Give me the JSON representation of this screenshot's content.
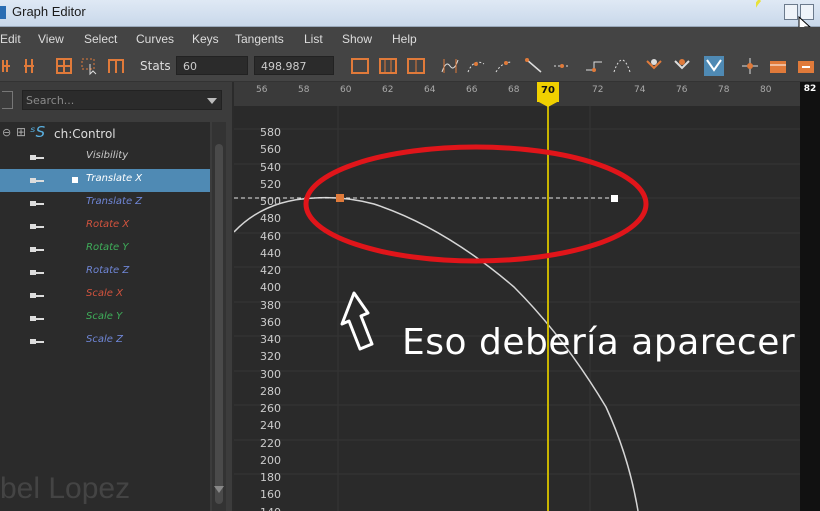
{
  "window": {
    "title": "Graph Editor"
  },
  "menu": [
    "Edit",
    "View",
    "Select",
    "Curves",
    "Keys",
    "Tangents",
    "List",
    "Show",
    "Help"
  ],
  "toolbar": {
    "stats_label": "Stats",
    "frame_value": "60",
    "value_value": "498.987"
  },
  "search": {
    "placeholder": "Search..."
  },
  "outliner": {
    "node": "ch:Control",
    "channels": [
      {
        "label": "Visibility",
        "color": "#c9c9c9",
        "selected": false
      },
      {
        "label": "Translate X",
        "color": "#ffffff",
        "selected": true
      },
      {
        "label": "Translate Z",
        "color": "#6f86d6",
        "selected": false
      },
      {
        "label": "Rotate X",
        "color": "#d2533e",
        "selected": false
      },
      {
        "label": "Rotate Y",
        "color": "#3fae5a",
        "selected": false
      },
      {
        "label": "Rotate Z",
        "color": "#6f86d6",
        "selected": false
      },
      {
        "label": "Scale X",
        "color": "#d2533e",
        "selected": false
      },
      {
        "label": "Scale Y",
        "color": "#3fae5a",
        "selected": false
      },
      {
        "label": "Scale Z",
        "color": "#6f86d6",
        "selected": false
      }
    ]
  },
  "timeline": {
    "frames": [
      "56",
      "58",
      "60",
      "62",
      "64",
      "66",
      "68",
      "72",
      "74",
      "76",
      "78",
      "80",
      "82"
    ],
    "current_frame": "70"
  },
  "value_axis": [
    "580",
    "560",
    "540",
    "520",
    "500",
    "480",
    "460",
    "440",
    "420",
    "400",
    "380",
    "360",
    "340",
    "320",
    "300",
    "280",
    "260",
    "240",
    "220",
    "200",
    "180",
    "160",
    "140"
  ],
  "annotation": {
    "text": "Eso debería aparecer"
  },
  "watermark": "bel Lopez",
  "colors": {
    "current_frame": "#f0d000",
    "selection": "#4f8ab4",
    "annotation": "#e0151a"
  }
}
